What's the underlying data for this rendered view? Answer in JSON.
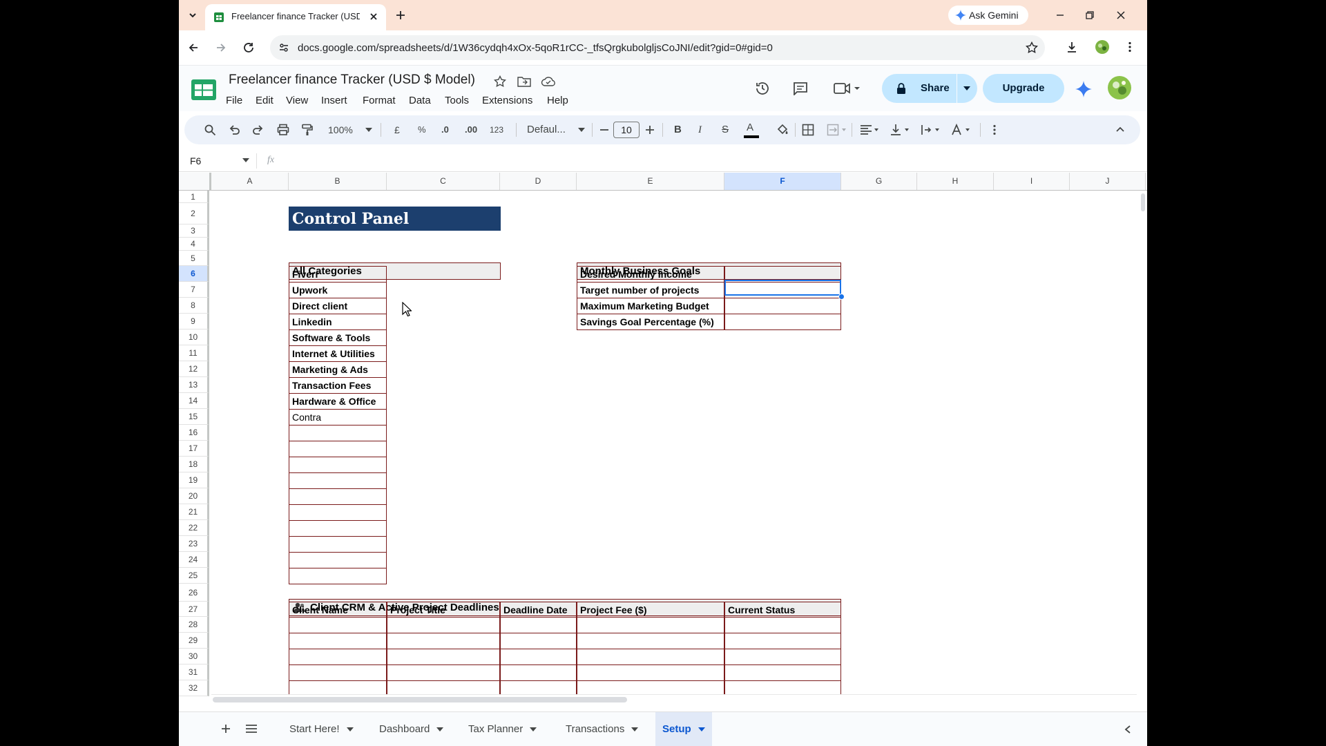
{
  "browser": {
    "tab_title": "Freelancer finance Tracker (USD $ Model)",
    "url": "docs.google.com/spreadsheets/d/1W36cydqh4xOx-5qoR1rCC-_tfsQrgkubolgljsCoJNI/edit?gid=0#gid=0",
    "ask_gemini_label": "Ask Gemini"
  },
  "doc": {
    "title": "Freelancer finance Tracker (USD $ Model)",
    "menu": [
      "File",
      "Edit",
      "View",
      "Insert",
      "Format",
      "Data",
      "Tools",
      "Extensions",
      "Help"
    ],
    "share_label": "Share",
    "upgrade_label": "Upgrade"
  },
  "toolbar": {
    "zoom": "100%",
    "currency": "£",
    "percent": "%",
    "dec_decrease": ".0",
    "dec_increase": ".00",
    "number_format": "123",
    "font": "Defaul...",
    "font_size": "10",
    "bold": "B",
    "italic": "I",
    "strike": "S",
    "text_color": "A"
  },
  "formula_bar": {
    "cell_ref": "F6",
    "fx": "fx",
    "value": ""
  },
  "grid": {
    "columns": [
      "A",
      "B",
      "C",
      "D",
      "E",
      "F",
      "G",
      "H",
      "I",
      "J"
    ],
    "selected_column": "F",
    "rows": [
      "1",
      "2",
      "3",
      "4",
      "5",
      "6",
      "7",
      "8",
      "9",
      "10",
      "11",
      "12",
      "13",
      "14",
      "15",
      "16",
      "17",
      "18",
      "19",
      "20",
      "21",
      "22",
      "23",
      "24",
      "25",
      "26",
      "27",
      "28",
      "29",
      "30",
      "31",
      "32"
    ],
    "selected_row": "6"
  },
  "control_panel": {
    "title": "Control Panel"
  },
  "categories": {
    "header": "All Categories",
    "items": [
      "Fiverr",
      "Upwork",
      "Direct client",
      "Linkedin",
      "Software & Tools",
      "Internet & Utilities",
      "Marketing & Ads",
      "Transaction Fees",
      "Hardware & Office",
      "Contra"
    ]
  },
  "goals": {
    "header": "Monthly Business Goals",
    "items": [
      "Desired Monthly Income",
      "Target number of projects",
      "Maximum Marketing Budget",
      "Savings Goal Percentage (%)"
    ]
  },
  "crm": {
    "icon": "people-icon",
    "header": "Client CRM & Active Project Deadlines",
    "columns": [
      "Client Name",
      "Project Title",
      "Deadline Date",
      "Project Fee ($)",
      "Current Status"
    ]
  },
  "sheets": {
    "tabs": [
      "Start Here!",
      "Dashboard",
      "Tax Planner",
      "Transactions",
      "Setup"
    ],
    "active": "Setup"
  },
  "colors": {
    "title_fill": "#1c3f6e",
    "header_fill": "#eeeeee",
    "border": "#7a1a1a",
    "selection": "#1a73e8"
  }
}
